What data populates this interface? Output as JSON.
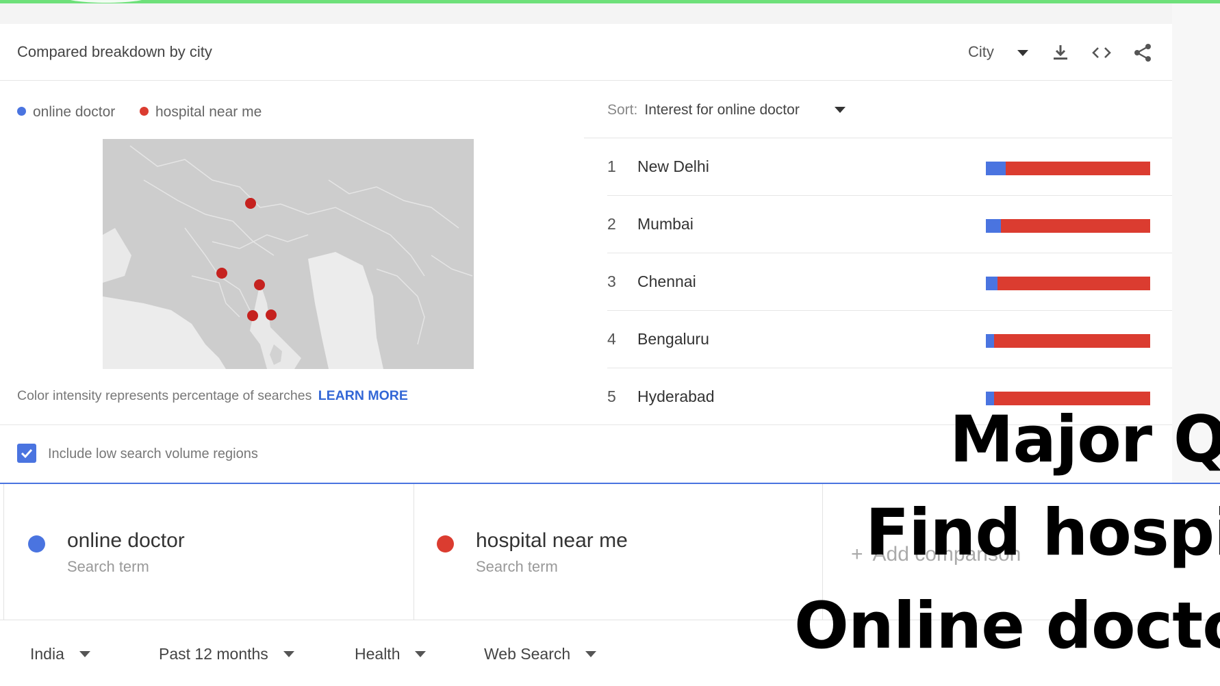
{
  "header": {
    "title": "Compared breakdown by city",
    "city_label": "City",
    "icons": [
      "download-icon",
      "embed-code-icon",
      "share-icon"
    ]
  },
  "legend": {
    "items": [
      {
        "label": "online doctor",
        "color": "#4a74e0"
      },
      {
        "label": "hospital near me",
        "color": "#db3c30"
      }
    ]
  },
  "map": {
    "note": "Color intensity represents percentage of searches",
    "learn_more": "LEARN MORE",
    "marker_color": "#c5221f",
    "base_color": "#cccccc"
  },
  "sort": {
    "label": "Sort:",
    "value": "Interest for online doctor"
  },
  "cities": [
    {
      "rank": "1",
      "name": "New Delhi",
      "online_doctor_share": 0.12
    },
    {
      "rank": "2",
      "name": "Mumbai",
      "online_doctor_share": 0.09
    },
    {
      "rank": "3",
      "name": "Chennai",
      "online_doctor_share": 0.07
    },
    {
      "rank": "4",
      "name": "Bengaluru",
      "online_doctor_share": 0.05
    },
    {
      "rank": "5",
      "name": "Hyderabad",
      "online_doctor_share": 0.05
    }
  ],
  "include_low_volume": {
    "label": "Include low search volume regions",
    "checked": true
  },
  "terms": [
    {
      "name": "online doctor",
      "sub": "Search term",
      "color": "#4a74e0"
    },
    {
      "name": "hospital near me",
      "sub": "Search term",
      "color": "#db3c30"
    }
  ],
  "add_comparison": {
    "plus": "+",
    "label": "Add comparison"
  },
  "filters": [
    {
      "label": "India"
    },
    {
      "label": "Past 12 months"
    },
    {
      "label": "Health"
    },
    {
      "label": "Web Search"
    }
  ],
  "overlay_lines": [
    "Major Q",
    "Find hospit",
    "Online docto"
  ]
}
